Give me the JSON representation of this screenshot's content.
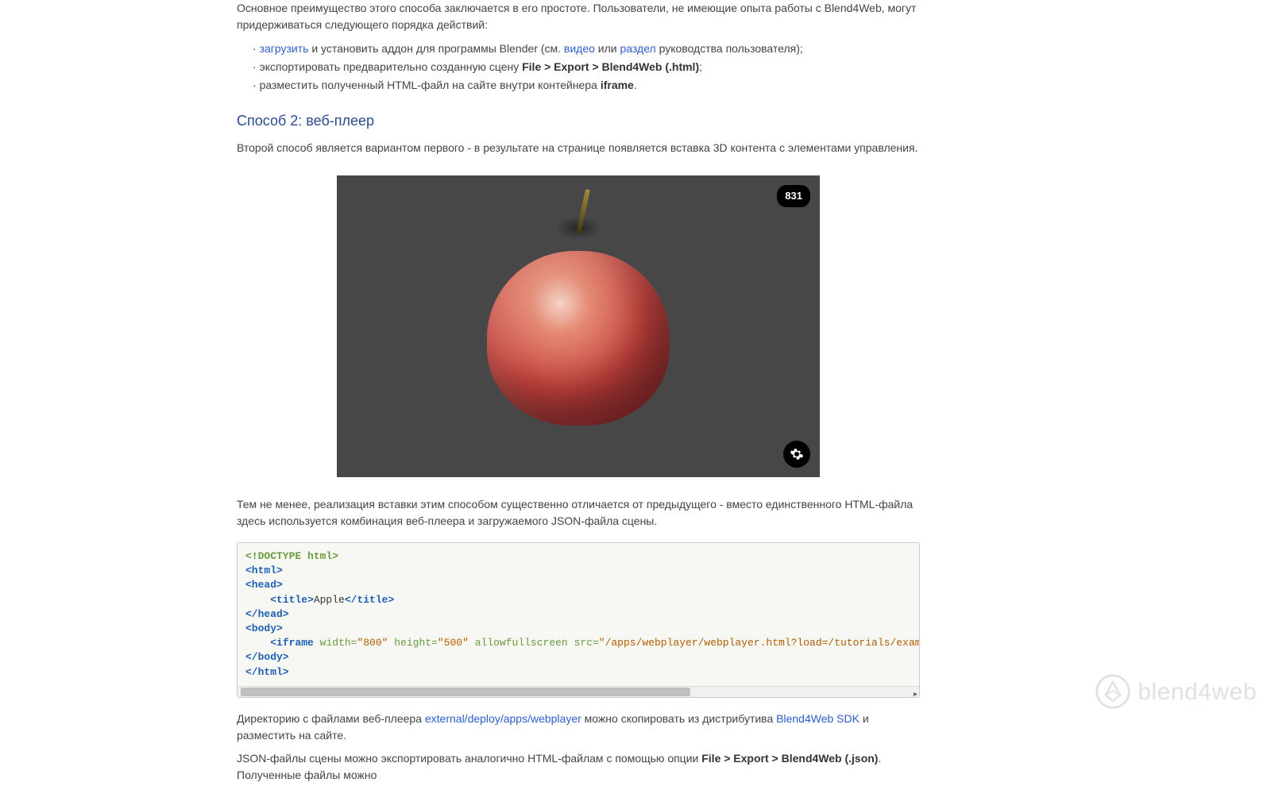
{
  "intro": {
    "para": "Основное преимущество этого способа заключается в его простоте. Пользователи, не имеющие опыта работы с Blend4Web, могут придерживаться следующего порядка действий:"
  },
  "steps": {
    "s1_link": "загрузить",
    "s1_mid": " и установить аддон для программы Blender (см. ",
    "s1_video": "видео",
    "s1_or": " или ",
    "s1_section": "раздел",
    "s1_end": " руководства пользователя);",
    "s2_a": "экспортировать предварительно созданную сцену ",
    "s2_strong": "File > Export > Blend4Web (.html)",
    "s2_b": ";",
    "s3_a": "разместить полученный HTML-файл на сайте внутри контейнера ",
    "s3_strong": "iframe",
    "s3_b": "."
  },
  "method2": {
    "heading": "Способ 2: веб-плеер",
    "para": "Второй способ является вариантом первого - в результате на странице появляется вставка 3D контента с элементами управления."
  },
  "viewer": {
    "counter": "831"
  },
  "after_viewer": {
    "para": "Тем не менее, реализация вставки этим способом существенно отличается от предыдущего - вместо единственного HTML-файла здесь используется комбинация веб-плеера и загружаемого JSON-файла сцены."
  },
  "code": {
    "doctype": "<!DOCTYPE html>",
    "html_open": "<html>",
    "head_open": "<head>",
    "title_open": "<title>",
    "title_text": "Apple",
    "title_close": "</title>",
    "head_close": "</head>",
    "body_open": "<body>",
    "iframe_tag": "<iframe",
    "iframe_attr_width": "width=",
    "iframe_val_width": "\"800\"",
    "iframe_attr_height": "height=",
    "iframe_val_height": "\"500\"",
    "iframe_attr_allow": "allowfullscreen",
    "iframe_attr_src": "src=",
    "iframe_val_src": "\"/apps/webplayer/webplayer.html?load=/tutorials/examples/we",
    "body_close": "</body>",
    "html_close": "</html>"
  },
  "after_code": {
    "p1_a": "Директорию с файлами веб-плеера ",
    "p1_link1": "external/deploy/apps/webplayer",
    "p1_b": " можно скопировать из дистрибутива ",
    "p1_link2": "Blend4Web SDK",
    "p1_c": " и разместить на сайте.",
    "p2_a": "JSON-файлы сцены можно экспортировать аналогично HTML-файлам с помощью опции ",
    "p2_strong": "File > Export > Blend4Web (.json)",
    "p2_b": ". Полученные файлы можно"
  },
  "watermark": {
    "text": "blend4web"
  }
}
